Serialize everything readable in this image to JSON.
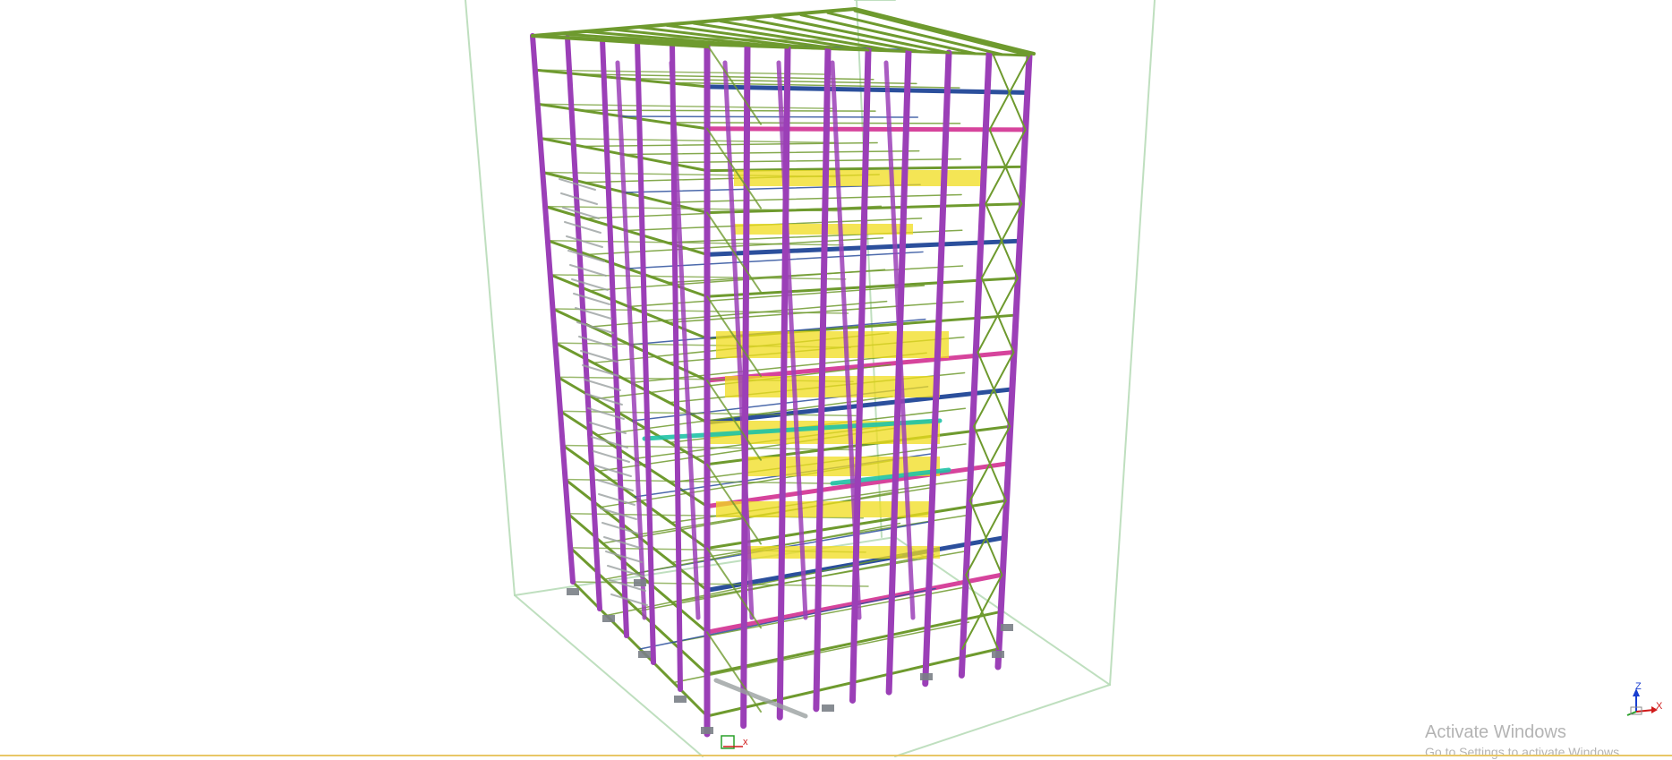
{
  "viewport": {
    "background": "#ffffff",
    "model_description_colors": {
      "column": "#9b3fb7",
      "bracing": "#6e9a2e",
      "beam_blue": "#2b4f9c",
      "beam_pink": "#d6449c",
      "equipment_yellow": "#f0dc1c",
      "pipe_teal": "#1fc2a6",
      "stair_grey": "#9aa0a0",
      "bounding_box": "#b8dcb8"
    }
  },
  "view_triad": {
    "labels": {
      "z": "Z",
      "x": "X"
    },
    "colors": {
      "z": "#1a3fd0",
      "x": "#d01a1a",
      "y": "#2aa02a"
    }
  },
  "origin_marker": {
    "label": "x"
  },
  "watermark": {
    "title": "Activate Windows",
    "subtitle": "Go to Settings to activate Windows."
  },
  "status_line_color": "#e8c766"
}
